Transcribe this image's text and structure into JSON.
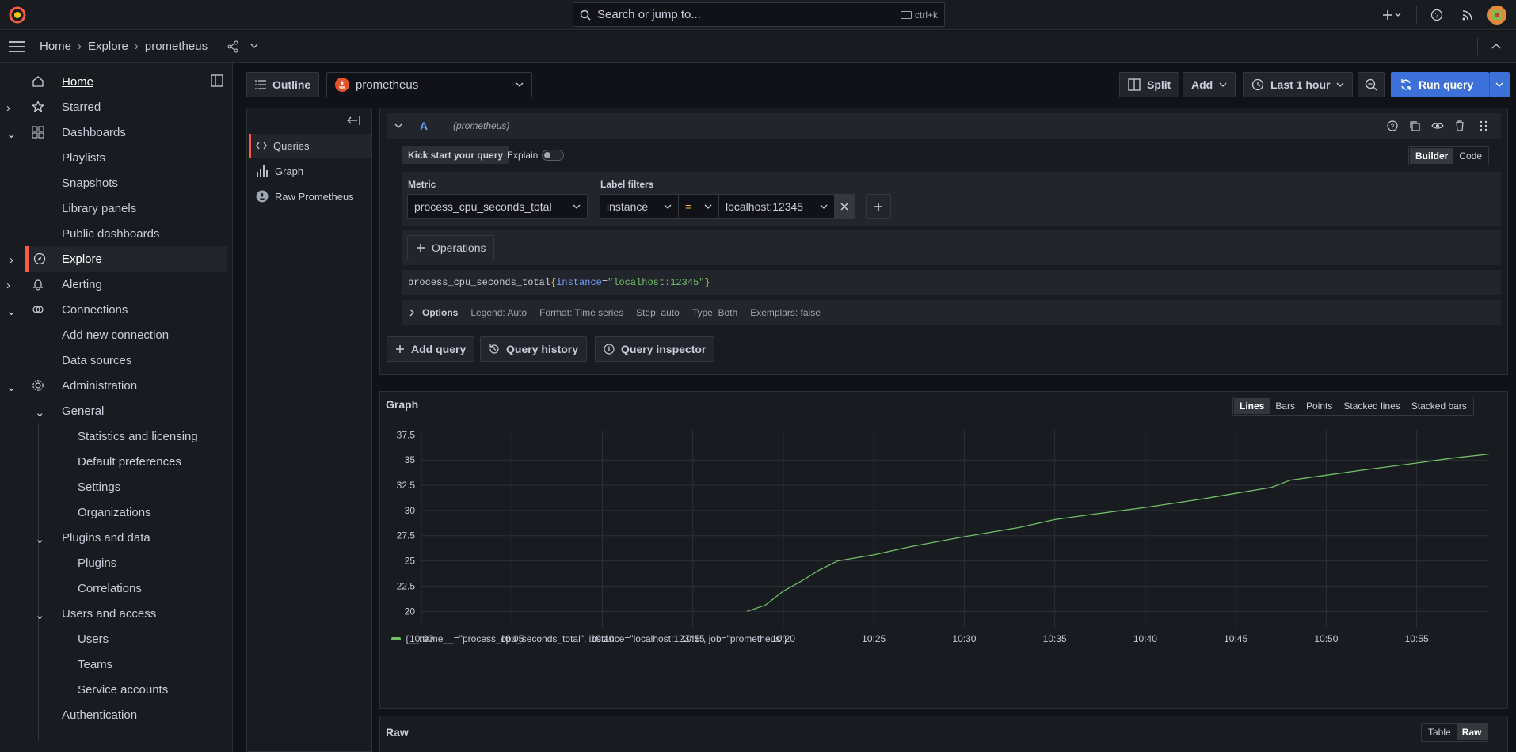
{
  "topbar": {
    "search_placeholder": "Search or jump to...",
    "search_shortcut": "ctrl+k"
  },
  "breadcrumb": {
    "home": "Home",
    "explore": "Explore",
    "current": "prometheus"
  },
  "sidebar": {
    "items": [
      {
        "label": "Home"
      },
      {
        "label": "Starred"
      },
      {
        "label": "Dashboards"
      },
      {
        "label": "Playlists"
      },
      {
        "label": "Snapshots"
      },
      {
        "label": "Library panels"
      },
      {
        "label": "Public dashboards"
      },
      {
        "label": "Explore"
      },
      {
        "label": "Alerting"
      },
      {
        "label": "Connections"
      },
      {
        "label": "Add new connection"
      },
      {
        "label": "Data sources"
      },
      {
        "label": "Administration"
      },
      {
        "label": "General"
      },
      {
        "label": "Statistics and licensing"
      },
      {
        "label": "Default preferences"
      },
      {
        "label": "Settings"
      },
      {
        "label": "Organizations"
      },
      {
        "label": "Plugins and data"
      },
      {
        "label": "Plugins"
      },
      {
        "label": "Correlations"
      },
      {
        "label": "Users and access"
      },
      {
        "label": "Users"
      },
      {
        "label": "Teams"
      },
      {
        "label": "Service accounts"
      },
      {
        "label": "Authentication"
      }
    ]
  },
  "toolbar": {
    "outline": "Outline",
    "datasource": "prometheus",
    "split": "Split",
    "add": "Add",
    "time_range": "Last 1 hour",
    "run_query": "Run query"
  },
  "outline": {
    "items": [
      "Queries",
      "Graph",
      "Raw Prometheus"
    ]
  },
  "query": {
    "ref": "A",
    "datasource_label": "(prometheus)",
    "kick_start": "Kick start your query",
    "explain": "Explain",
    "builder": "Builder",
    "code": "Code",
    "metric_label": "Metric",
    "metric_value": "process_cpu_seconds_total",
    "label_filters_label": "Label filters",
    "filter_key": "instance",
    "filter_op": "=",
    "filter_value": "localhost:12345",
    "operations": "Operations",
    "preview_metric": "process_cpu_seconds_total",
    "preview_open": "{",
    "preview_key": "instance",
    "preview_eq": "=",
    "preview_val": "\"localhost:12345\"",
    "preview_close": "}",
    "options_label": "Options",
    "options_summary": [
      "Legend: Auto",
      "Format: Time series",
      "Step: auto",
      "Type: Both",
      "Exemplars: false"
    ]
  },
  "actions": {
    "add_query": "Add query",
    "query_history": "Query history",
    "query_inspector": "Query inspector"
  },
  "graph": {
    "title": "Graph",
    "modes": [
      "Lines",
      "Bars",
      "Points",
      "Stacked lines",
      "Stacked bars"
    ],
    "selected_mode": "Lines"
  },
  "raw": {
    "title": "Raw",
    "modes": [
      "Table",
      "Raw"
    ],
    "selected_mode": "Raw"
  },
  "colors": {
    "accent": "#f55f3e",
    "series": "#73bf69",
    "primary": "#3d71d9"
  },
  "chart_data": {
    "type": "line",
    "title": "Graph",
    "xlabel": "",
    "ylabel": "",
    "x_ticks": [
      "10:00",
      "10:05",
      "10:10",
      "10:15",
      "10:20",
      "10:25",
      "10:30",
      "10:35",
      "10:40",
      "10:45",
      "10:50",
      "10:55"
    ],
    "y_ticks": [
      "20",
      "22.5",
      "25",
      "27.5",
      "30",
      "32.5",
      "35",
      "37.5"
    ],
    "ylim": [
      19,
      38
    ],
    "xlim": [
      "10:00",
      "10:59"
    ],
    "grid": true,
    "legend_position": "bottom-left",
    "series": [
      {
        "name": "{__name__=\"process_cpu_seconds_total\", instance=\"localhost:12345\", job=\"prometheus\"}",
        "x": [
          "10:18",
          "10:19",
          "10:20",
          "10:21",
          "10:22",
          "10:23",
          "10:25",
          "10:27",
          "10:30",
          "10:33",
          "10:35",
          "10:37",
          "10:40",
          "10:43",
          "10:45",
          "10:47",
          "10:48",
          "10:50",
          "10:52",
          "10:55",
          "10:57",
          "10:59"
        ],
        "y": [
          20.0,
          20.6,
          22.0,
          23.0,
          24.1,
          25.0,
          25.6,
          26.4,
          27.4,
          28.3,
          29.1,
          29.6,
          30.3,
          31.1,
          31.7,
          32.3,
          33.0,
          33.5,
          34.0,
          34.7,
          35.2,
          35.6
        ]
      }
    ]
  }
}
